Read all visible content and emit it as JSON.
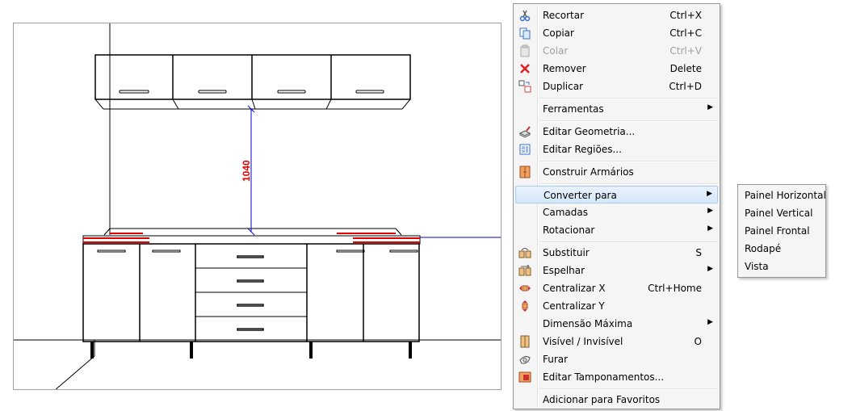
{
  "context_menu": {
    "items": [
      {
        "label": "Recortar",
        "shortcut": "Ctrl+X",
        "icon": "scissors-icon"
      },
      {
        "label": "Copiar",
        "shortcut": "Ctrl+C",
        "icon": "copy-icon"
      },
      {
        "label": "Colar",
        "shortcut": "Ctrl+V",
        "icon": "paste-icon",
        "disabled": true
      },
      {
        "label": "Remover",
        "shortcut": "Delete",
        "icon": "delete-x-icon"
      },
      {
        "label": "Duplicar",
        "shortcut": "Ctrl+D",
        "icon": "duplicate-icon"
      },
      {
        "label": "Ferramentas",
        "submenu": true
      },
      {
        "label": "Editar Geometria...",
        "icon": "edit-geometry-icon"
      },
      {
        "label": "Editar Regiões...",
        "icon": "edit-regions-icon"
      },
      {
        "label": "Construir Armários",
        "icon": "build-cabinets-icon"
      },
      {
        "label": "Converter para",
        "submenu": true,
        "highlighted": true
      },
      {
        "label": "Camadas",
        "submenu": true
      },
      {
        "label": "Rotacionar",
        "submenu": true
      },
      {
        "label": "Substituir",
        "shortcut": "S",
        "icon": "replace-icon"
      },
      {
        "label": "Espelhar",
        "submenu": true,
        "icon": "mirror-icon"
      },
      {
        "label": "Centralizar X",
        "shortcut": "Ctrl+Home",
        "icon": "center-x-icon"
      },
      {
        "label": "Centralizar Y",
        "icon": "center-y-icon"
      },
      {
        "label": "Dimensão Máxima",
        "submenu": true
      },
      {
        "label": "Visível / Invisível",
        "shortcut": "O",
        "icon": "visibility-icon"
      },
      {
        "label": "Furar",
        "icon": "drill-icon"
      },
      {
        "label": "Editar Tamponamentos...",
        "icon": "edit-covers-icon"
      },
      {
        "label": "Adicionar para Favoritos"
      }
    ]
  },
  "submenu": {
    "items": [
      {
        "label": "Painel Horizontal"
      },
      {
        "label": "Painel Vertical"
      },
      {
        "label": "Painel Frontal"
      },
      {
        "label": "Rodapé"
      },
      {
        "label": "Vista"
      }
    ]
  },
  "drawing": {
    "dimension_label": "1040",
    "dimension_color": "#e00000",
    "guide_color": "#0000cc",
    "highlight_color": "#e00000"
  }
}
